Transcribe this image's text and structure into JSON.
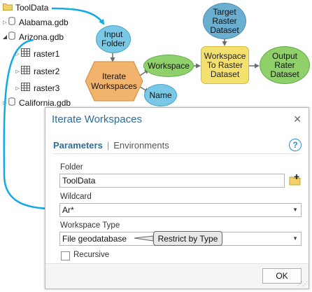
{
  "tree": {
    "root": "ToolData",
    "items": [
      {
        "label": "Alabama.gdb"
      },
      {
        "label": "Arizona.gdb"
      },
      {
        "label": "raster1"
      },
      {
        "label": "raster2"
      },
      {
        "label": "raster3"
      },
      {
        "label": "California.gdb"
      }
    ]
  },
  "model": {
    "input_folder": "Input\nFolder",
    "iterate_tool": "Iterate\nWorkspaces",
    "workspace_var": "Workspace",
    "name_var": "Name",
    "target_raster": "Target\nRaster\nDataset",
    "ws_to_raster_tool": "Workspace\nTo Raster\nDataset",
    "output_raster": "Output\nRater\nDataset"
  },
  "dialog": {
    "title": "Iterate Workspaces",
    "tabs": {
      "parameters": "Parameters",
      "separator": "|",
      "environments": "Environments"
    },
    "help_glyph": "?",
    "close_glyph": "✕",
    "folder": {
      "label": "Folder",
      "value": "ToolData"
    },
    "wildcard": {
      "label": "Wildcard",
      "value": "Ar*"
    },
    "workspace_type": {
      "label": "Workspace Type",
      "value": "File geodatabase"
    },
    "recursive": {
      "label": "Recursive",
      "checked": false
    },
    "ok_label": "OK"
  },
  "callout": {
    "text": "Restrict by Type"
  },
  "colors": {
    "arrow": "#12a9e6",
    "input_var": "#79c8e6",
    "tool": "#f4e06e",
    "iterator": "#f2b36c",
    "output": "#8fd06b",
    "title": "#2d6d9c"
  }
}
